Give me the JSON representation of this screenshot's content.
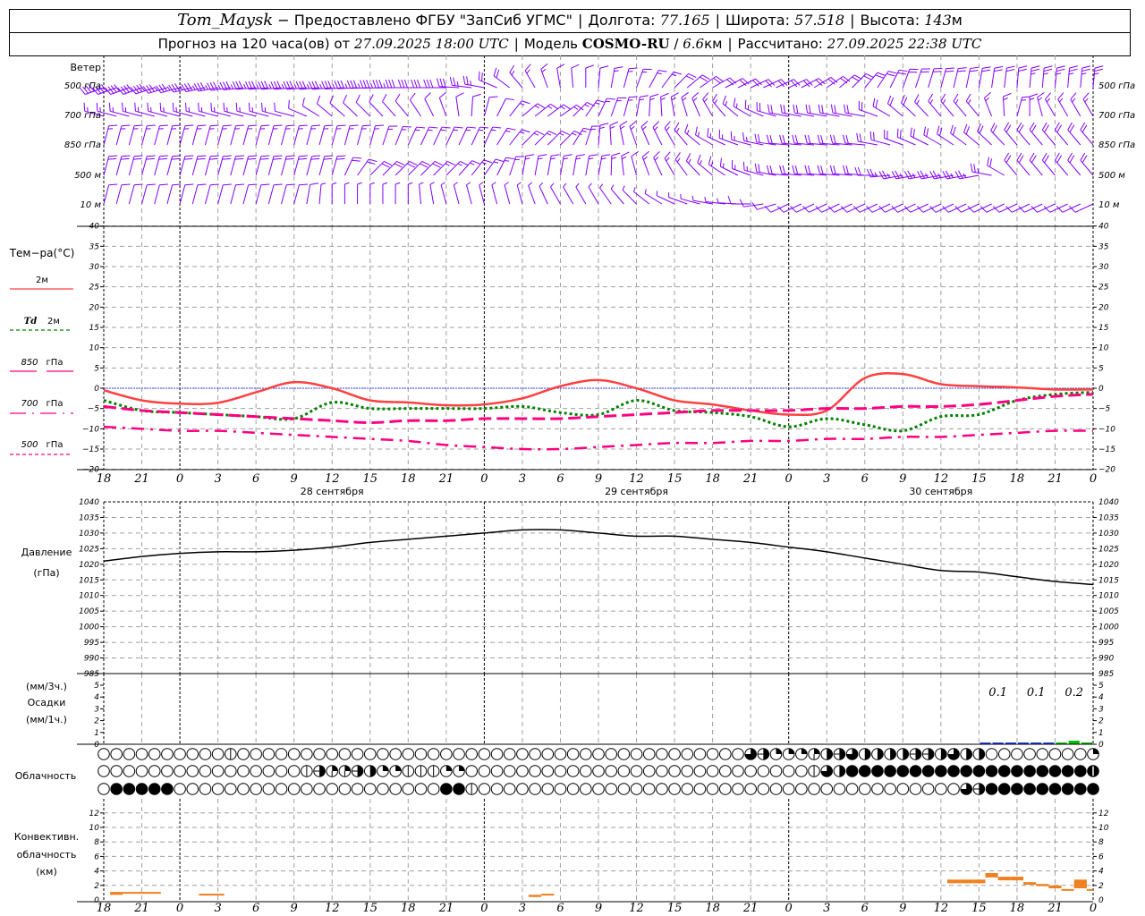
{
  "header": {
    "station": "Tom_Maysk",
    "provider": " − Предоставлено ФГБУ \"ЗапСиб УГМС\"",
    "lon_label": "Долгота: ",
    "lon": "77.165",
    "lat_label": "Широта: ",
    "lat": "57.518",
    "alt_label": "Высота: ",
    "alt": "143",
    "alt_unit": "м",
    "forecast_label": "Прогноз на 120 часа(ов) от ",
    "forecast_start": "27.09.2025 18:00 UTC",
    "model_label": "Модель ",
    "model": "COSMO-RU",
    "res_sep": " / ",
    "resolution": "6.6",
    "res_unit": "км",
    "calc_label": "Рассчитано: ",
    "calc_time": "27.09.2025 22:38 UTC",
    "divider": "|"
  },
  "labels": {
    "wind": "Ветер",
    "wind_levels": [
      "500 гПа",
      "700 гПа",
      "850 гПа",
      "500 м",
      "10  м"
    ],
    "temp_title": "Тем−ра(°C)",
    "legend": [
      {
        "label": "2м",
        "color": "#ff4040"
      },
      {
        "label_it": "Td",
        "label": "2м",
        "color": "#008000"
      },
      {
        "label_it": "850",
        "label": "гПа",
        "color": "#ff0080"
      },
      {
        "label_it": "700",
        "label": "гПа",
        "color": "#ff0080"
      },
      {
        "label_it": "500",
        "label": "гПа",
        "color": "#ff0080"
      }
    ],
    "pressure": [
      "Давление",
      "(гПа)"
    ],
    "precip": [
      "(мм/3ч.)",
      "Осадки",
      "(мм/1ч.)"
    ],
    "cloud": "Облачность",
    "convective": [
      "Конвективн.",
      "облачность",
      "(км)"
    ],
    "dates": [
      {
        "hour": 18,
        "text": "28 сентября"
      },
      {
        "hour": 42,
        "text": "29 сентября"
      },
      {
        "hour": 66,
        "text": "30 сентября"
      }
    ]
  },
  "colors": {
    "wind": "#8000ff",
    "t2m": "#ff4040",
    "td2m": "#008000",
    "upper": "#ff0080",
    "zero_line": "#3040ff",
    "pressure": "#000000",
    "rain": "#2040e0",
    "mixed": "#00c000",
    "convective": "#f08020",
    "grid": "#a0a0a0"
  },
  "chart_data": [
    {
      "type": "wind_barbs",
      "title": "Ветер",
      "hours_step": 3,
      "x_start": "27.09.2025 18 UTC",
      "x_hours": [
        0,
        3,
        6,
        9,
        12,
        15,
        18,
        21,
        24,
        27,
        30,
        33,
        36,
        39,
        42,
        45,
        48,
        51,
        54,
        57,
        60,
        63,
        66,
        69,
        72,
        75,
        78
      ],
      "levels": [
        {
          "name": "500 гПа",
          "dir": [
            250,
            250,
            255,
            260,
            265,
            265,
            265,
            268,
            270,
            270,
            280,
            320,
            350,
            5,
            20,
            45,
            60,
            65,
            65,
            55,
            40,
            20,
            15,
            10,
            5,
            5,
            5
          ],
          "speed": [
            20,
            20,
            18,
            18,
            18,
            18,
            18,
            17,
            16,
            15,
            12,
            8,
            6,
            6,
            7,
            9,
            10,
            11,
            11,
            10,
            9,
            9,
            9,
            10,
            11,
            12,
            12
          ]
        },
        {
          "name": "700 гПа",
          "dir": [
            285,
            285,
            285,
            285,
            285,
            285,
            310,
            315,
            320,
            340,
            15,
            50,
            55,
            25,
            10,
            350,
            330,
            300,
            280,
            280,
            280,
            310,
            320,
            320,
            15,
            330,
            330
          ],
          "speed": [
            7,
            7,
            7,
            7,
            7,
            6,
            6,
            6,
            6,
            6,
            5,
            7,
            8,
            8,
            8,
            7,
            7,
            7,
            10,
            10,
            10,
            10,
            8,
            8,
            8,
            8,
            8
          ]
        },
        {
          "name": "850 гПа",
          "dir": [
            15,
            15,
            15,
            15,
            15,
            15,
            15,
            15,
            25,
            25,
            25,
            45,
            45,
            5,
            340,
            330,
            300,
            285,
            275,
            275,
            275,
            290,
            300,
            310,
            320,
            320,
            320
          ],
          "speed": [
            8,
            8,
            8,
            8,
            8,
            8,
            8,
            8,
            8,
            8,
            8,
            8,
            8,
            8,
            8,
            8,
            8,
            8,
            10,
            10,
            10,
            10,
            10,
            10,
            10,
            10,
            10
          ]
        },
        {
          "name": "500 м",
          "dir": [
            15,
            15,
            15,
            15,
            15,
            15,
            15,
            45,
            45,
            45,
            35,
            10,
            10,
            10,
            345,
            330,
            310,
            290,
            275,
            275,
            275,
            260,
            260,
            260,
            320,
            320,
            320
          ],
          "speed": [
            9,
            9,
            9,
            9,
            9,
            9,
            9,
            10,
            10,
            8,
            8,
            8,
            8,
            8,
            6,
            7,
            8,
            8,
            10,
            10,
            10,
            12,
            12,
            12,
            10,
            10,
            10
          ]
        },
        {
          "name": "10 м",
          "dir": [
            15,
            15,
            15,
            15,
            15,
            15,
            0,
            0,
            0,
            345,
            345,
            345,
            330,
            330,
            315,
            295,
            280,
            270,
            245,
            245,
            245,
            245,
            245,
            245,
            245,
            245,
            245
          ],
          "speed": [
            5,
            5,
            5,
            5,
            5,
            5,
            3,
            3,
            3,
            3,
            3,
            3,
            3,
            3,
            3,
            3,
            3,
            4,
            4,
            4,
            4,
            4,
            4,
            4,
            4,
            4,
            4
          ]
        }
      ]
    },
    {
      "type": "line",
      "ylabel": "Тем−ра(°C)",
      "ylim": [
        -20,
        40
      ],
      "yticks": [
        40,
        35,
        30,
        25,
        20,
        15,
        10,
        5,
        0,
        -5,
        -10,
        -15,
        -20
      ],
      "grid": true,
      "x_hours": [
        0,
        3,
        6,
        9,
        12,
        15,
        18,
        21,
        24,
        27,
        30,
        33,
        36,
        39,
        42,
        45,
        48,
        51,
        54,
        57,
        60,
        63,
        66,
        69,
        72,
        75,
        78
      ],
      "x_tick_labels": [
        "18",
        "21",
        "0",
        "3",
        "6",
        "9",
        "12",
        "15",
        "18",
        "21",
        "0",
        "3",
        "6",
        "9",
        "12",
        "15",
        "18",
        "21",
        "0",
        "3",
        "6",
        "9",
        "12",
        "15",
        "18",
        "21",
        "0"
      ],
      "series": [
        {
          "name": "2м",
          "style": "solid",
          "values": [
            -0.5,
            -3,
            -3.8,
            -3.6,
            -1,
            1.5,
            0,
            -3,
            -3.5,
            -4.2,
            -4,
            -2.5,
            0.5,
            2,
            0,
            -3,
            -4,
            -5.5,
            -6.5,
            -5.5,
            2.5,
            3.5,
            1,
            0.5,
            0.2,
            -0.3,
            -0.3
          ]
        },
        {
          "name": "Td 2м",
          "style": "dotted",
          "values": [
            -3,
            -5.5,
            -6,
            -6.5,
            -7,
            -7.5,
            -3.5,
            -5,
            -5,
            -5,
            -5,
            -4.5,
            -6,
            -6.5,
            -3,
            -5.5,
            -6,
            -7,
            -9.5,
            -7.5,
            -9,
            -10.5,
            -7,
            -6.5,
            -3,
            -1.5,
            -1
          ]
        },
        {
          "name": "850 гПа",
          "style": "dashed",
          "values": [
            -4.5,
            -5.5,
            -6,
            -6.5,
            -7,
            -7.5,
            -8,
            -8.5,
            -8,
            -8,
            -7.5,
            -7.5,
            -7.5,
            -7,
            -6.5,
            -6,
            -5.5,
            -5.5,
            -5.5,
            -5,
            -5,
            -4.5,
            -4.5,
            -4,
            -3,
            -2,
            -1.5
          ]
        },
        {
          "name": "700 гПа",
          "style": "dashdot",
          "values": [
            -9.5,
            -10,
            -10.5,
            -10.5,
            -11,
            -11.5,
            -12,
            -12.5,
            -13,
            -14,
            -14.5,
            -15,
            -15,
            -14.5,
            -14,
            -13.5,
            -13.5,
            -13,
            -13,
            -12.5,
            -12.5,
            -12,
            -12,
            -11.5,
            -11,
            -10.5,
            -10.5
          ]
        }
      ]
    },
    {
      "type": "line",
      "ylabel": "Давление (гПа)",
      "ylim": [
        985,
        1040
      ],
      "yticks": [
        1040,
        1035,
        1030,
        1025,
        1020,
        1015,
        1010,
        1005,
        1000,
        995,
        990,
        985
      ],
      "grid": true,
      "x_hours": [
        0,
        3,
        6,
        9,
        12,
        15,
        18,
        21,
        24,
        27,
        30,
        33,
        36,
        39,
        42,
        45,
        48,
        51,
        54,
        57,
        60,
        63,
        66,
        69,
        72,
        75,
        78
      ],
      "values": [
        1021,
        1022.5,
        1023.5,
        1024,
        1024,
        1024.5,
        1025.5,
        1027,
        1028,
        1029,
        1030,
        1031,
        1031,
        1030,
        1029,
        1029,
        1028,
        1027,
        1025.5,
        1024,
        1022,
        1020,
        1018,
        1017.5,
        1016,
        1014.5,
        1013.5
      ]
    },
    {
      "type": "bar",
      "ylabel": "Осадки (мм/1ч.)",
      "ylim": [
        0,
        5
      ],
      "yticks": [
        0,
        1,
        2,
        3,
        4,
        5
      ],
      "bars": [
        {
          "hour": 70,
          "value": 0.02,
          "kind": "rain"
        },
        {
          "hour": 71,
          "value": 0.05,
          "kind": "rain"
        },
        {
          "hour": 72,
          "value": 0.05,
          "kind": "rain"
        },
        {
          "hour": 73,
          "value": 0.05,
          "kind": "rain"
        },
        {
          "hour": 74,
          "value": 0.05,
          "kind": "rain"
        },
        {
          "hour": 75,
          "value": 0.02,
          "kind": "rain"
        },
        {
          "hour": 76,
          "value": 0.05,
          "kind": "mixed"
        },
        {
          "hour": 77,
          "value": 0.1,
          "kind": "mixed"
        },
        {
          "hour": 78,
          "value": 0.05,
          "kind": "mixed"
        }
      ],
      "sums_3h": [
        {
          "hour": 70.5,
          "text": "0.1"
        },
        {
          "hour": 73.5,
          "text": "0.1"
        },
        {
          "hour": 76.5,
          "text": "0.2"
        }
      ]
    },
    {
      "type": "cloud_octas",
      "title": "Облачность",
      "hourly": true,
      "rows": [
        [
          0,
          0,
          0,
          0,
          0,
          0,
          0,
          0,
          0,
          0,
          1,
          0,
          0,
          0,
          0,
          0,
          0,
          0,
          0,
          0,
          0,
          0,
          0,
          0,
          0,
          0,
          0,
          0,
          0,
          0,
          0,
          0,
          0,
          0,
          0,
          0,
          0,
          0,
          0,
          0,
          0,
          0,
          0,
          0,
          0,
          0,
          0,
          0,
          0,
          0,
          0,
          6,
          5,
          2,
          2,
          2,
          3,
          4,
          5,
          6,
          4,
          4,
          4,
          4,
          5,
          5,
          4,
          6,
          4,
          4,
          0,
          0,
          0,
          0,
          0,
          0,
          0,
          0,
          2
        ],
        [
          0,
          0,
          0,
          0,
          0,
          0,
          0,
          0,
          0,
          0,
          0,
          0,
          0,
          0,
          0,
          0,
          1,
          5,
          3,
          3,
          5,
          4,
          2,
          2,
          1,
          1,
          1,
          2,
          2,
          0,
          0,
          0,
          0,
          0,
          0,
          0,
          0,
          0,
          0,
          0,
          0,
          0,
          0,
          0,
          0,
          0,
          0,
          0,
          0,
          0,
          0,
          0,
          0,
          0,
          0,
          0,
          1,
          6,
          4,
          8,
          8,
          8,
          8,
          8,
          8,
          8,
          8,
          8,
          8,
          8,
          8,
          8,
          8,
          8,
          8,
          8,
          8,
          8,
          7
        ],
        [
          0,
          8,
          8,
          8,
          8,
          8,
          0,
          0,
          0,
          0,
          0,
          0,
          0,
          0,
          0,
          0,
          0,
          0,
          0,
          0,
          0,
          0,
          0,
          0,
          0,
          0,
          0,
          8,
          8,
          1,
          0,
          0,
          0,
          0,
          0,
          0,
          0,
          0,
          0,
          0,
          0,
          0,
          0,
          0,
          0,
          0,
          0,
          0,
          0,
          0,
          0,
          0,
          0,
          0,
          0,
          0,
          0,
          0,
          0,
          0,
          0,
          0,
          0,
          0,
          0,
          0,
          0,
          0,
          6,
          5,
          8,
          8,
          8,
          8,
          8,
          8,
          8,
          8,
          8
        ]
      ]
    },
    {
      "type": "range_bar",
      "ylabel": "Конвективн. облачность (км)",
      "ylim": [
        0,
        13
      ],
      "yticks": [
        0,
        2,
        4,
        6,
        8,
        10,
        12
      ],
      "bars": [
        {
          "hour": 1,
          "base": 0.7,
          "top": 1.1
        },
        {
          "hour": 2,
          "base": 0.9,
          "top": 1.1
        },
        {
          "hour": 3,
          "base": 0.9,
          "top": 1.1
        },
        {
          "hour": 4,
          "base": 0.9,
          "top": 1.1
        },
        {
          "hour": 8,
          "base": 0.65,
          "top": 0.85
        },
        {
          "hour": 9,
          "base": 0.65,
          "top": 0.85
        },
        {
          "hour": 34,
          "base": 0.4,
          "top": 0.7
        },
        {
          "hour": 35,
          "base": 0.6,
          "top": 0.85
        },
        {
          "hour": 67,
          "base": 2.3,
          "top": 2.8
        },
        {
          "hour": 68,
          "base": 2.3,
          "top": 2.8
        },
        {
          "hour": 69,
          "base": 2.3,
          "top": 2.8
        },
        {
          "hour": 70,
          "base": 3.1,
          "top": 3.7
        },
        {
          "hour": 71,
          "base": 2.7,
          "top": 3.2
        },
        {
          "hour": 72,
          "base": 2.7,
          "top": 3.2
        },
        {
          "hour": 73,
          "base": 2.1,
          "top": 2.45
        },
        {
          "hour": 74,
          "base": 1.9,
          "top": 2.2
        },
        {
          "hour": 75,
          "base": 1.6,
          "top": 2.0
        },
        {
          "hour": 76,
          "base": 1.3,
          "top": 1.5
        },
        {
          "hour": 77,
          "base": 1.6,
          "top": 2.8
        },
        {
          "hour": 78,
          "base": 1.3,
          "top": 1.5
        }
      ]
    }
  ]
}
